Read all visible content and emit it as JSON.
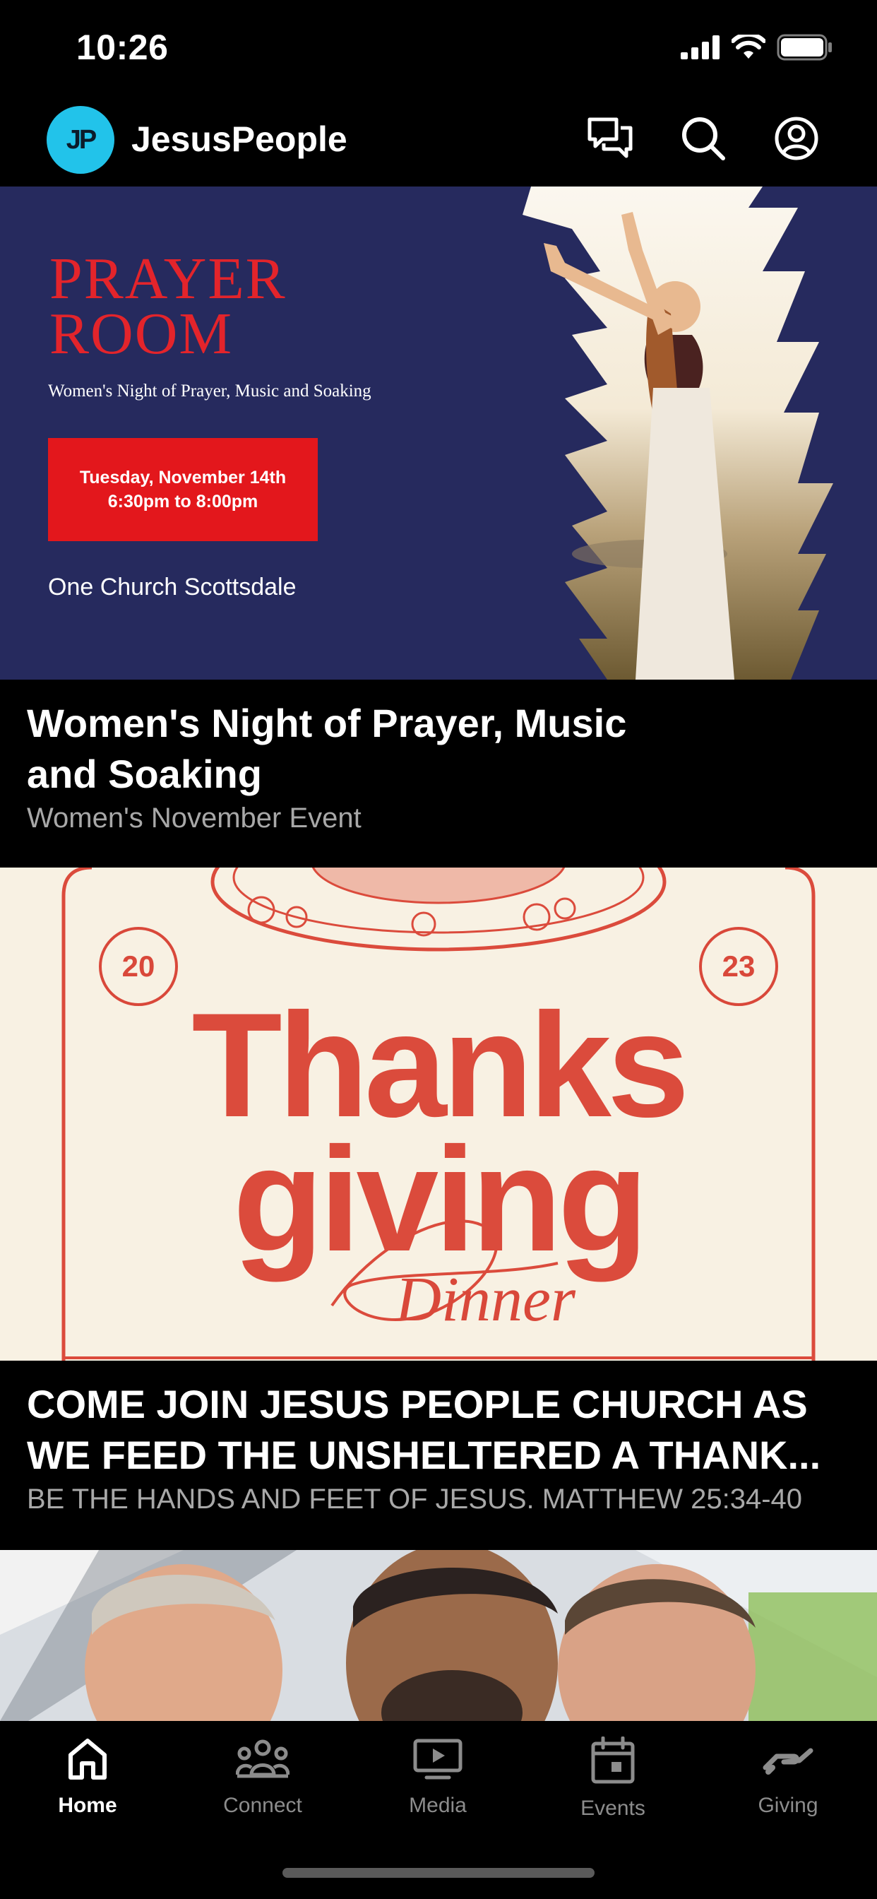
{
  "status_bar": {
    "time": "10:26"
  },
  "header": {
    "logo_text": "JP",
    "app_name": "JesusPeople"
  },
  "feed": [
    {
      "banner": {
        "heading_line1": "PRAYER",
        "heading_line2": "ROOM",
        "subtitle": "Women's Night of Prayer, Music and Soaking",
        "date_line1": "Tuesday, November 14th",
        "date_line2": "6:30pm to 8:00pm",
        "location": "One Church Scottsdale"
      },
      "title": "Women's Night of Prayer, Music and Soaking",
      "subtitle": "Women's November Event"
    },
    {
      "banner": {
        "year_left": "20",
        "year_right": "23",
        "word1": "Thanks",
        "word2": "giving",
        "word3": "Dinner"
      },
      "title": "COME JOIN  JESUS PEOPLE CHURCH AS WE FEED THE UNSHELTERED A THANK...",
      "subtitle": "BE THE HANDS AND FEET OF JESUS. MATTHEW 25:34-40"
    },
    {
      "banner": {}
    }
  ],
  "tab_bar": {
    "tabs": [
      {
        "label": "Home",
        "icon": "home-icon",
        "active": true
      },
      {
        "label": "Connect",
        "icon": "people-icon",
        "active": false
      },
      {
        "label": "Media",
        "icon": "tv-icon",
        "active": false
      },
      {
        "label": "Events",
        "icon": "calendar-icon",
        "active": false
      },
      {
        "label": "Giving",
        "icon": "giving-hand-icon",
        "active": false
      }
    ]
  },
  "colors": {
    "logo_bg": "#22c3ea",
    "prayer_bg": "#262a5e",
    "prayer_red": "#e3242b",
    "thanksgiving_bg": "#f8f1e3",
    "thanksgiving_red": "#db4b3c"
  }
}
